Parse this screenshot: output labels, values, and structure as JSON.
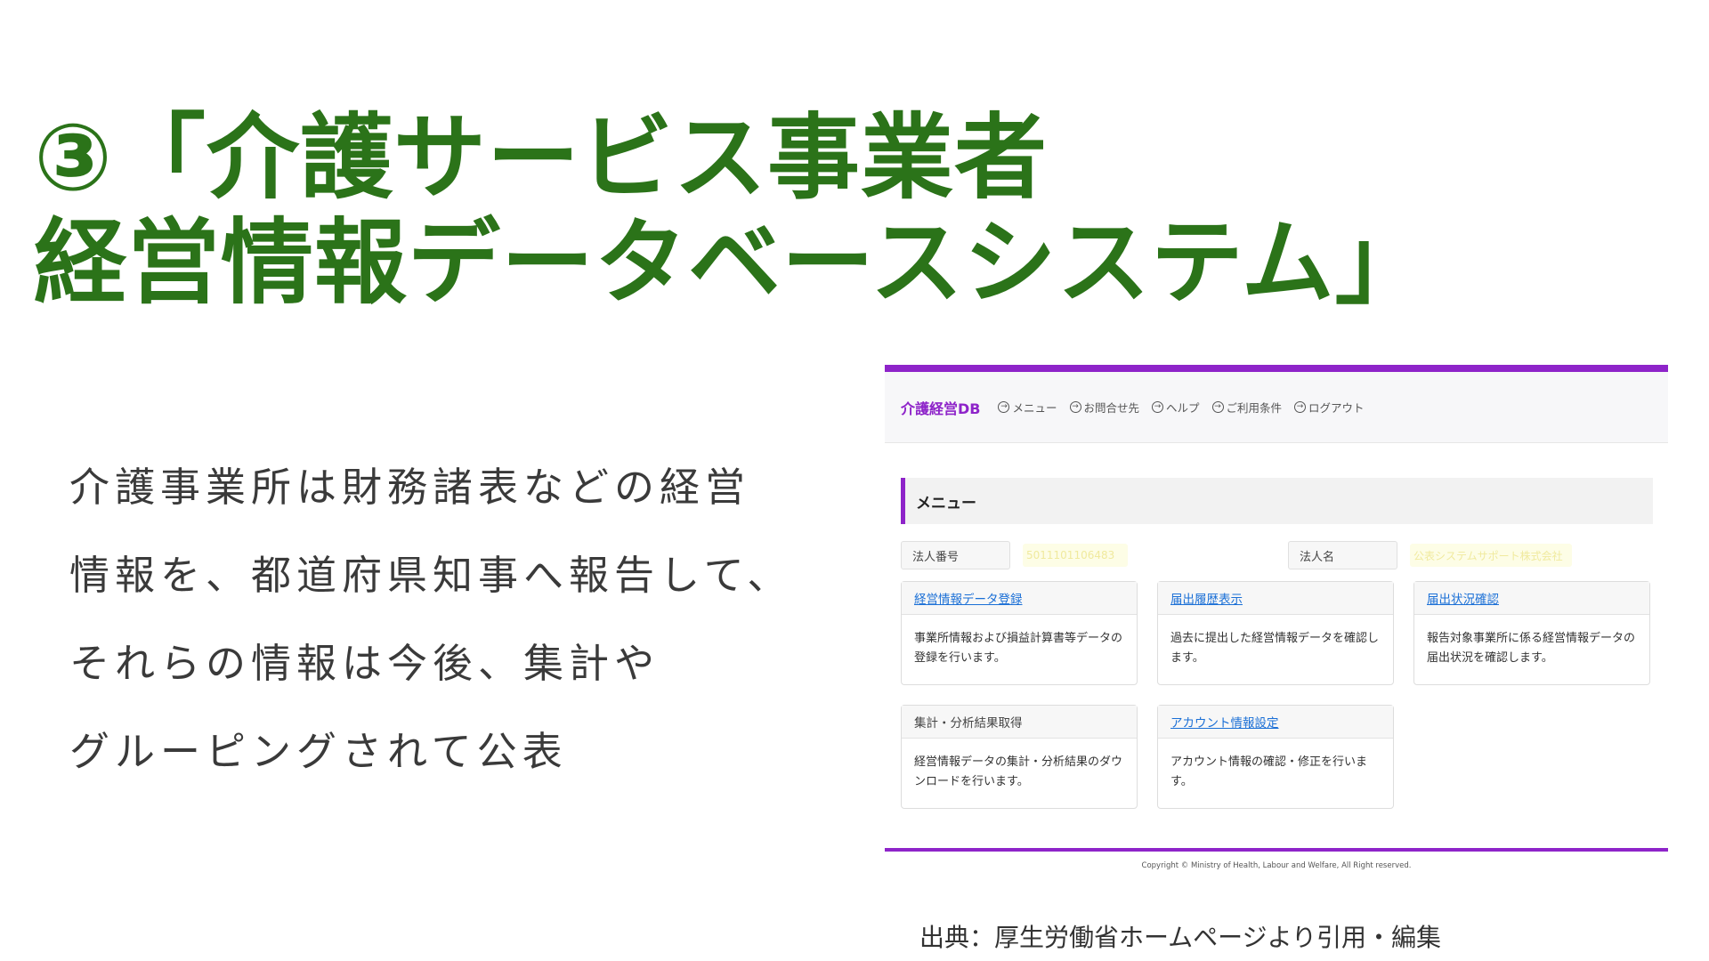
{
  "slide": {
    "title_line1": "③「介護サービス事業者",
    "title_line2": "経営情報データベースシステム」",
    "body_lines": [
      "介護事業所は財務諸表などの経営",
      "情報を、都道府県知事へ報告して、",
      "それらの情報は今後、集計や",
      "グルーピングされて公表"
    ],
    "source": "出典：厚生労働省ホームページより引用・編集"
  },
  "app": {
    "brand": "介護経営DB",
    "nav": [
      {
        "label": "メニュー",
        "icon": "arrow-right-circle-icon"
      },
      {
        "label": "お問合せ先",
        "icon": "arrow-right-circle-icon"
      },
      {
        "label": "ヘルプ",
        "icon": "arrow-right-circle-icon"
      },
      {
        "label": "ご利用条件",
        "icon": "arrow-right-circle-icon"
      },
      {
        "label": "ログアウト",
        "icon": "arrow-right-circle-icon"
      }
    ],
    "section_title": "メニュー",
    "corp_number_label": "法人番号",
    "corp_number_value": "5011101106483",
    "corp_name_label": "法人名",
    "corp_name_value": "公表システムサポート株式会社",
    "cards": [
      {
        "title": "経営情報データ登録",
        "body": "事業所情報および損益計算書等データの登録を行います。",
        "link": true
      },
      {
        "title": "届出履歴表示",
        "body": "過去に提出した経営情報データを確認します。",
        "link": true
      },
      {
        "title": "届出状況確認",
        "body": "報告対象事業所に係る経営情報データの届出状況を確認します。",
        "link": true
      },
      {
        "title": "集計・分析結果取得",
        "body": "経営情報データの集計・分析結果のダウンロードを行います。",
        "link": false
      },
      {
        "title": "アカウント情報設定",
        "body": "アカウント情報の確認・修正を行います。",
        "link": true
      }
    ],
    "copyright": "Copyright © Ministry of Health, Labour and Welfare, All Right reserved."
  },
  "colors": {
    "title_green": "#2b7319",
    "accent_purple": "#8e24c9",
    "link_blue": "#1a6fd6"
  }
}
